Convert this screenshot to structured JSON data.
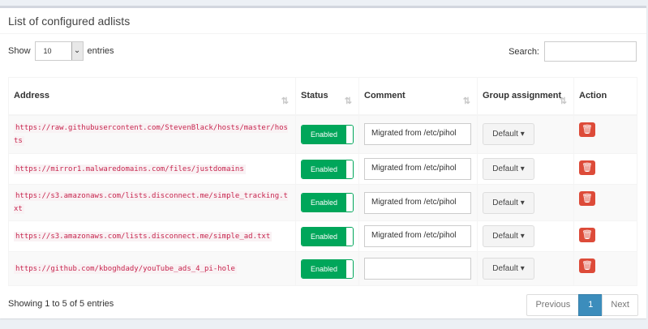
{
  "box": {
    "title": "List of configured adlists"
  },
  "length": {
    "show_label": "Show",
    "value": "10",
    "entries_label": "entries"
  },
  "search": {
    "label": "Search:",
    "value": ""
  },
  "table": {
    "columns": [
      "Address",
      "Status",
      "Comment",
      "Group assignment",
      "Action"
    ],
    "rows": [
      {
        "address": "https://raw.githubusercontent.com/StevenBlack/hosts/master/hosts",
        "status": "Enabled",
        "comment": "Migrated from /etc/pihol",
        "group": "Default"
      },
      {
        "address": "https://mirror1.malwaredomains.com/files/justdomains",
        "status": "Enabled",
        "comment": "Migrated from /etc/pihol",
        "group": "Default"
      },
      {
        "address": "https://s3.amazonaws.com/lists.disconnect.me/simple_tracking.txt",
        "status": "Enabled",
        "comment": "Migrated from /etc/pihol",
        "group": "Default"
      },
      {
        "address": "https://s3.amazonaws.com/lists.disconnect.me/simple_ad.txt",
        "status": "Enabled",
        "comment": "Migrated from /etc/pihol",
        "group": "Default"
      },
      {
        "address": "https://github.com/kboghdady/youTube_ads_4_pi-hole",
        "status": "Enabled",
        "comment": "",
        "group": "Default"
      }
    ]
  },
  "info": "Showing 1 to 5 of 5 entries",
  "pagination": {
    "previous": "Previous",
    "current": "1",
    "next": "Next"
  },
  "icons": {
    "sort": "sort-icon",
    "caret": "caret-down-icon",
    "trash": "trash-icon"
  },
  "colors": {
    "enabled": "#00a65a",
    "delete": "#dd4b39",
    "active_page": "#3c8dbc",
    "address": "#c7254e"
  }
}
